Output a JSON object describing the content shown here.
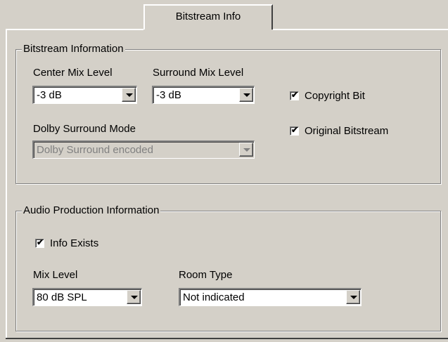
{
  "tab": {
    "label": "Bitstream Info"
  },
  "bitstream": {
    "title": "Bitstream Information",
    "center_mix": {
      "label": "Center Mix Level",
      "value": "-3 dB"
    },
    "surround_mix": {
      "label": "Surround Mix Level",
      "value": "-3 dB"
    },
    "dolby_surround": {
      "label": "Dolby Surround Mode",
      "value": "Dolby Surround encoded"
    },
    "copyright": {
      "label": "Copyright Bit",
      "checked": true
    },
    "original": {
      "label": "Original Bitstream",
      "checked": true
    }
  },
  "audio_production": {
    "title": "Audio Production Information",
    "info_exists": {
      "label": "Info Exists",
      "checked": true
    },
    "mix_level": {
      "label": "Mix Level",
      "value": "80 dB SPL"
    },
    "room_type": {
      "label": "Room Type",
      "value": "Not indicated"
    }
  },
  "check_glyph": "✔"
}
